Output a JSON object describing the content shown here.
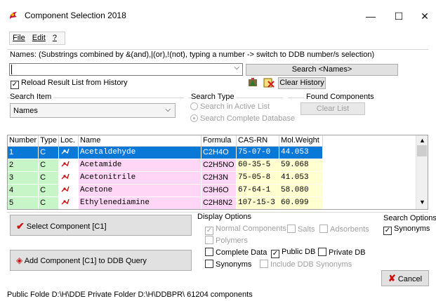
{
  "window": {
    "title": "Component Selection 2018",
    "controls": {
      "minimize": "—",
      "maximize": "☐",
      "close": "✕"
    }
  },
  "menu": {
    "file": "File",
    "edit": "Edit",
    "help": "?"
  },
  "names": {
    "label": "Names: (Substrings combined by &(and),|(or),!(not), typing a number -> switch to DDB number/s selection)",
    "input_value": "",
    "search_button": "Search <Names>",
    "reload_label": "Reload Result List from History",
    "reload_checked": true,
    "clear_history": "Clear History"
  },
  "search_item": {
    "label": "Search Item",
    "selected": "Names"
  },
  "search_type": {
    "label": "Search Type",
    "option_active": "Search in  Active List",
    "option_complete": "Search Complete Database",
    "selected": "complete"
  },
  "found_components": {
    "label": "Found Components",
    "clear_list": "Clear List"
  },
  "grid": {
    "columns": [
      "Number",
      "Type",
      "Loc.",
      "Name",
      "Formula",
      "CAS-RN",
      "Mol.Weight"
    ],
    "rows": [
      {
        "number": "1",
        "type": "C",
        "name": "Acetaldehyde",
        "formula": "C2H4O",
        "cas": "75-07-0",
        "mw": "44.053",
        "selected": true,
        "color": "#0a78d7"
      },
      {
        "number": "2",
        "type": "C",
        "name": "Acetamide",
        "formula": "C2H5NO",
        "cas": "60-35-5",
        "mw": "59.068",
        "selected": false,
        "color": "#ffd6f5"
      },
      {
        "number": "3",
        "type": "C",
        "name": "Acetonitrile",
        "formula": "C2H3N",
        "cas": "75-05-8",
        "mw": "41.053",
        "selected": false,
        "color": "#ffd6f5"
      },
      {
        "number": "4",
        "type": "C",
        "name": "Acetone",
        "formula": "C3H6O",
        "cas": "67-64-1",
        "mw": "58.080",
        "selected": false,
        "color": "#ffd6f5"
      },
      {
        "number": "5",
        "type": "C",
        "name": "Ethylenediamine",
        "formula": "C2H8N2",
        "cas": "107-15-3",
        "mw": "60.099",
        "selected": false,
        "color": "#ffd6f5"
      }
    ],
    "left_bg": "#c8f5c8",
    "cas_bg": "#ffffd0"
  },
  "actions": {
    "select_component": "Select Component [C1]",
    "add_component": "Add Component [C1] to DDB Query",
    "cancel": "Cancel"
  },
  "display_options": {
    "label": "Display Options",
    "normal": {
      "label": "Normal Components",
      "checked": true,
      "enabled": false
    },
    "salts": {
      "label": "Salts",
      "checked": false,
      "enabled": false
    },
    "adsorbents": {
      "label": "Adsorbents",
      "checked": false,
      "enabled": false
    },
    "polymers": {
      "label": "Polymers",
      "checked": false,
      "enabled": false
    },
    "complete_data": {
      "label": "Complete Data",
      "checked": false,
      "enabled": true
    },
    "public_db": {
      "label": "Public DB",
      "checked": true,
      "enabled": true
    },
    "private_db": {
      "label": "Private DB",
      "checked": false,
      "enabled": true
    },
    "synonyms": {
      "label": "Synonyms",
      "checked": false,
      "enabled": true
    },
    "include_ddb_synonyms": {
      "label": "Include DDB Synonyms",
      "checked": false,
      "enabled": false
    }
  },
  "search_options": {
    "label": "Search Options",
    "synonyms": "Synonyms",
    "synonyms_checked": true
  },
  "status": {
    "text": "Public Folde  D:\\H\\DDE Private Folder D:\\H\\DDBPR\\ 61204 components"
  }
}
